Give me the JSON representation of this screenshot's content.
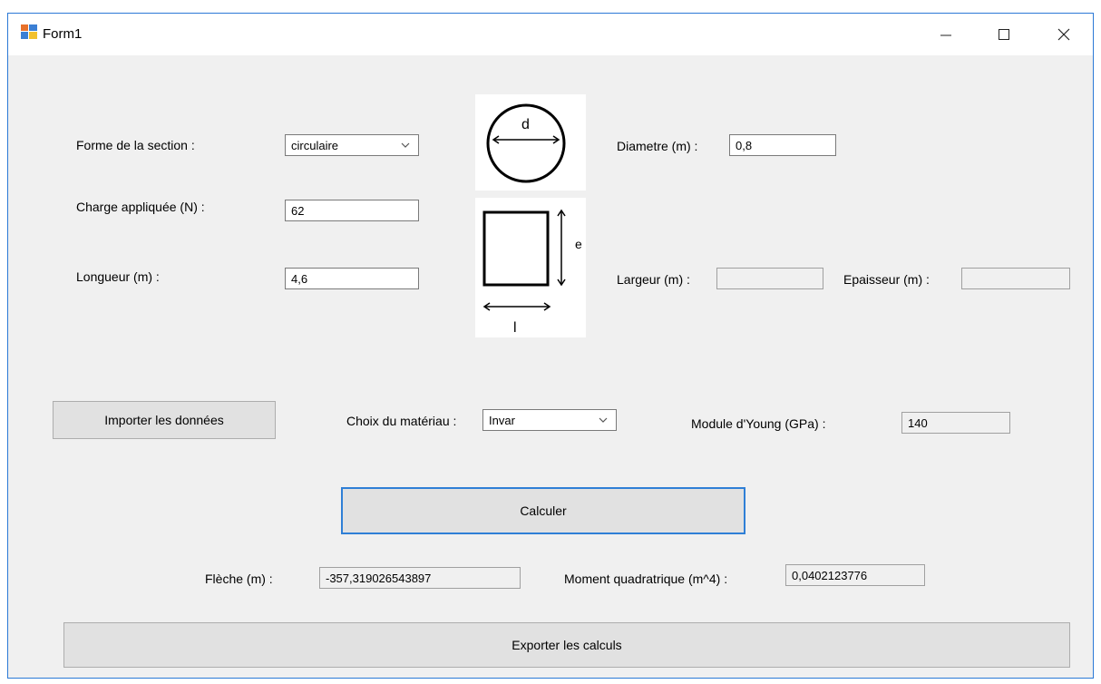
{
  "window": {
    "title": "Form1"
  },
  "labels": {
    "forme": "Forme de la section :",
    "charge": "Charge appliquée (N) :",
    "longueur": "Longueur (m) :",
    "diametre": "Diametre (m) :",
    "largeur": "Largeur (m) :",
    "epaisseur": "Epaisseur (m) :",
    "materiau": "Choix du matériau :",
    "young": "Module d'Young (GPa) :",
    "fleche": "Flèche (m) :",
    "moment": "Moment quadratrique (m^4) :"
  },
  "fields": {
    "forme": "circulaire",
    "charge": "62",
    "longueur": "4,6",
    "diametre": "0,8",
    "largeur": "",
    "epaisseur": "",
    "materiau": "Invar",
    "young": "140",
    "fleche": "-357,319026543897",
    "moment": "0,0402123776"
  },
  "buttons": {
    "importer": "Importer les données",
    "calculer": "Calculer",
    "exporter": "Exporter les calculs"
  },
  "diagrams": {
    "circle_label": "d",
    "rect_height_label": "e",
    "rect_width_label": "l"
  }
}
